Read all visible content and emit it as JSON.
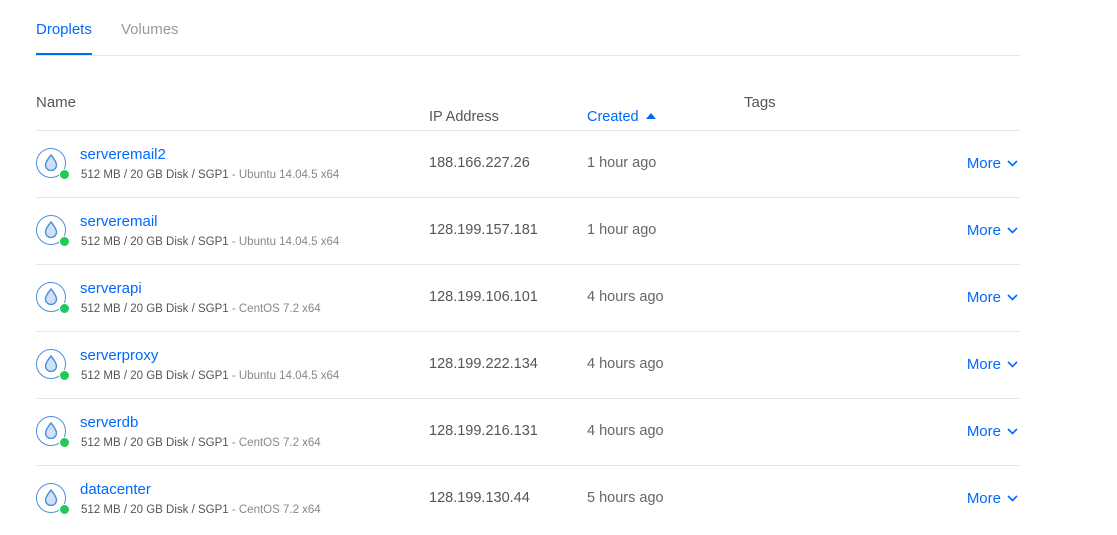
{
  "tabs": [
    {
      "label": "Droplets",
      "active": true
    },
    {
      "label": "Volumes",
      "active": false
    }
  ],
  "columns": {
    "name": "Name",
    "ip": "IP Address",
    "created": "Created",
    "tags": "Tags"
  },
  "colors": {
    "accent": "#0069ff",
    "status_on": "#1fca5b"
  },
  "droplets": [
    {
      "name": "serveremail2",
      "specs": "512 MB / 20 GB Disk / SGP1",
      "os": " - Ubuntu 14.04.5 x64",
      "ip": "188.166.227.26",
      "created": "1 hour ago",
      "more": "More"
    },
    {
      "name": "serveremail",
      "specs": "512 MB / 20 GB Disk / SGP1",
      "os": " - Ubuntu 14.04.5 x64",
      "ip": "128.199.157.181",
      "created": "1 hour ago",
      "more": "More"
    },
    {
      "name": "serverapi",
      "specs": "512 MB / 20 GB Disk / SGP1",
      "os": " - CentOS 7.2 x64",
      "ip": "128.199.106.101",
      "created": "4 hours ago",
      "more": "More"
    },
    {
      "name": "serverproxy",
      "specs": "512 MB / 20 GB Disk / SGP1",
      "os": " - Ubuntu 14.04.5 x64",
      "ip": "128.199.222.134",
      "created": "4 hours ago",
      "more": "More"
    },
    {
      "name": "serverdb",
      "specs": "512 MB / 20 GB Disk / SGP1",
      "os": " - CentOS 7.2 x64",
      "ip": "128.199.216.131",
      "created": "4 hours ago",
      "more": "More"
    },
    {
      "name": "datacenter",
      "specs": "512 MB / 20 GB Disk / SGP1",
      "os": " - CentOS 7.2 x64",
      "ip": "128.199.130.44",
      "created": "5 hours ago",
      "more": "More"
    }
  ]
}
